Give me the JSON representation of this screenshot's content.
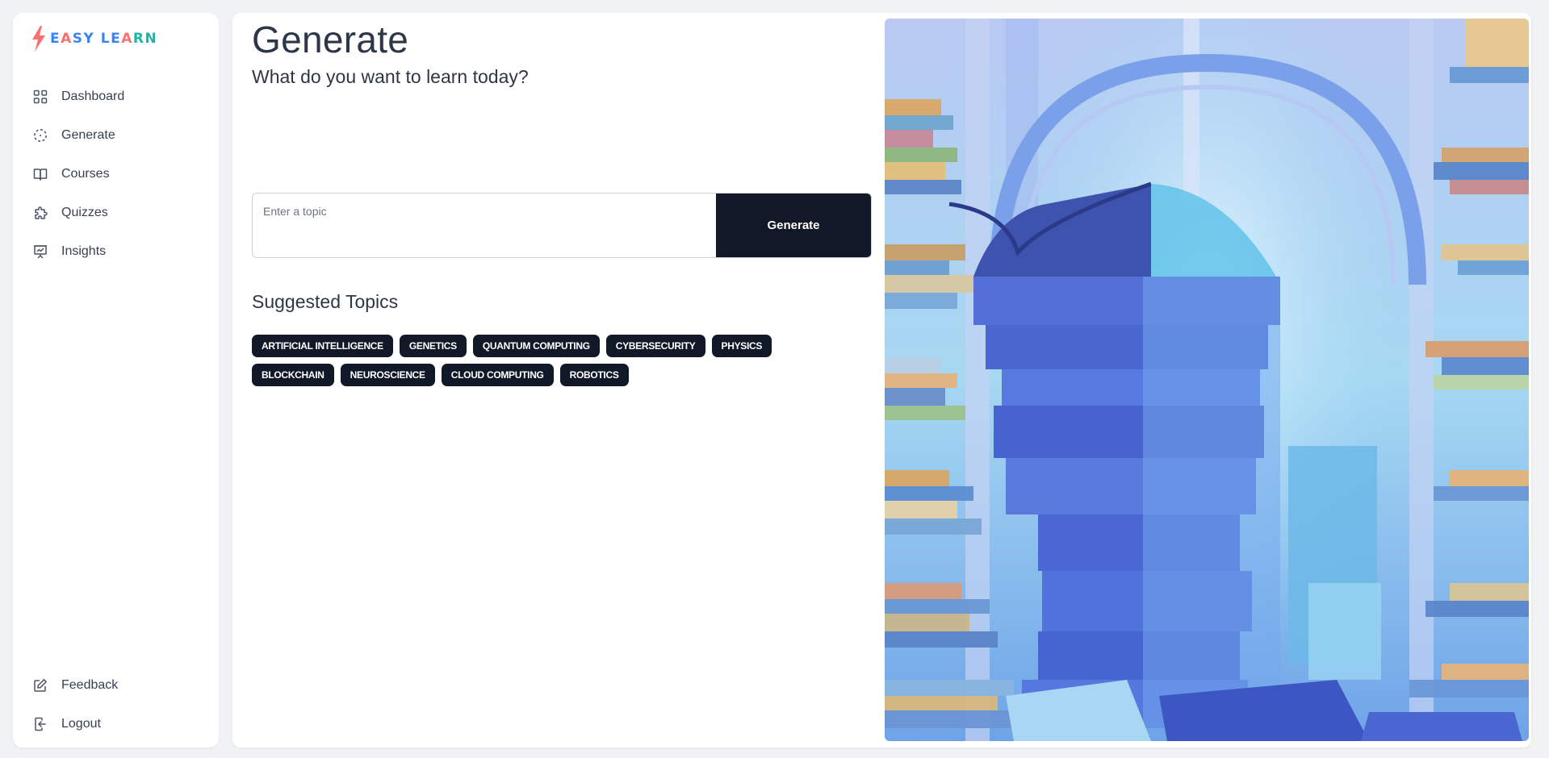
{
  "brand": {
    "logo_text_a": "E",
    "logo_text_b": "A",
    "logo_text_c": "SY LE",
    "logo_text_d": "A",
    "logo_text_e": "RN"
  },
  "sidebar": {
    "items": [
      {
        "label": "Dashboard",
        "icon": "grid-icon"
      },
      {
        "label": "Generate",
        "icon": "dashed-circle-icon"
      },
      {
        "label": "Courses",
        "icon": "book-open-icon"
      },
      {
        "label": "Quizzes",
        "icon": "puzzle-icon"
      },
      {
        "label": "Insights",
        "icon": "presentation-chart-icon"
      }
    ],
    "bottom_items": [
      {
        "label": "Feedback",
        "icon": "edit-icon"
      },
      {
        "label": "Logout",
        "icon": "logout-icon"
      }
    ]
  },
  "main": {
    "title": "Generate",
    "subtitle": "What do you want to learn today?",
    "input_placeholder": "Enter a topic",
    "generate_label": "Generate",
    "suggested_title": "Suggested Topics",
    "topics": [
      "ARTIFICIAL INTELLIGENCE",
      "GENETICS",
      "QUANTUM COMPUTING",
      "CYBERSECURITY",
      "PHYSICS",
      "BLOCKCHAIN",
      "NEUROSCIENCE",
      "CLOUD COMPUTING",
      "ROBOTICS"
    ]
  },
  "colors": {
    "accent_dark": "#111827",
    "logo_red": "#f87171",
    "logo_blue": "#3b82f6",
    "logo_teal": "#14b8a6"
  }
}
